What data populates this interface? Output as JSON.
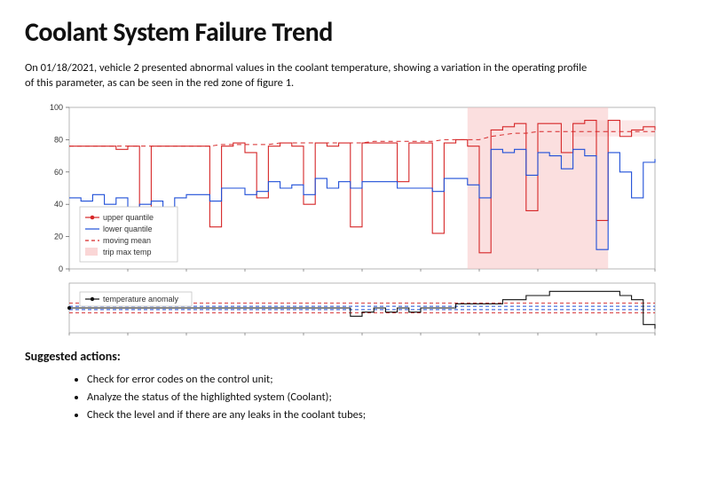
{
  "title": "Coolant System Failure Trend",
  "intro": "On 01/18/2021, vehicle 2 presented abnormal values in the coolant temperature, showing a variation in the operating profile of this parameter, as can be seen in the red zone of figure 1.",
  "suggested_heading": "Suggested actions:",
  "actions": [
    "Check for error codes on the control unit;",
    "Analyze the status of the highlighted system (Coolant);",
    "Check the level and if there are any leaks in the coolant tubes;"
  ],
  "chart_data": [
    {
      "type": "line",
      "title": "",
      "xlabel": "",
      "ylabel": "",
      "ylim": [
        0,
        100
      ],
      "yticks": [
        0,
        20,
        40,
        60,
        80,
        100
      ],
      "x": [
        0,
        2,
        4,
        6,
        8,
        10,
        12,
        14,
        16,
        18,
        20,
        22,
        24,
        26,
        28,
        30,
        32,
        34,
        36,
        38,
        40,
        42,
        44,
        46,
        48,
        50,
        52,
        54,
        56,
        58,
        60,
        62,
        64,
        66,
        68,
        70,
        72,
        74,
        76,
        78,
        80,
        82,
        84,
        86,
        88,
        90,
        92,
        94,
        96,
        98,
        100
      ],
      "series": [
        {
          "name": "upper quantile",
          "color": "#d62728",
          "style": "solid",
          "marker": "dot",
          "values": [
            76,
            76,
            76,
            76,
            74,
            76,
            34,
            76,
            76,
            76,
            76,
            76,
            26,
            76,
            78,
            72,
            44,
            76,
            78,
            76,
            40,
            78,
            76,
            78,
            26,
            78,
            78,
            78,
            54,
            78,
            78,
            22,
            78,
            80,
            76,
            10,
            86,
            88,
            90,
            36,
            90,
            90,
            72,
            90,
            92,
            30,
            92,
            82,
            86,
            88,
            86
          ]
        },
        {
          "name": "lower quantile",
          "color": "#1f4fd8",
          "style": "solid",
          "values": [
            44,
            42,
            46,
            40,
            44,
            38,
            40,
            42,
            38,
            44,
            46,
            46,
            42,
            50,
            50,
            46,
            48,
            54,
            50,
            52,
            46,
            56,
            50,
            54,
            50,
            54,
            54,
            54,
            50,
            50,
            50,
            48,
            56,
            56,
            52,
            44,
            74,
            72,
            74,
            58,
            72,
            70,
            62,
            74,
            70,
            12,
            72,
            60,
            44,
            66,
            68
          ]
        },
        {
          "name": "moving mean",
          "color": "#d62728",
          "style": "dashed",
          "values": [
            76,
            76,
            76,
            76,
            76,
            76,
            76,
            76,
            76,
            76,
            76,
            76,
            76,
            77,
            77,
            77,
            77,
            77,
            78,
            78,
            78,
            78,
            78,
            78,
            78,
            78,
            79,
            79,
            79,
            79,
            79,
            79,
            80,
            80,
            80,
            80,
            82,
            83,
            84,
            84,
            85,
            85,
            85,
            85,
            85,
            85,
            85,
            85,
            85,
            85,
            85
          ]
        }
      ],
      "highlight_zone": {
        "name": "trip max temp",
        "x_start": 68,
        "x_end": 92,
        "color": "#f8c4c4"
      },
      "legend_entries": [
        "upper quantile",
        "lower quantile",
        "moving mean",
        "trip max temp"
      ]
    },
    {
      "type": "line",
      "title": "",
      "xlabel": "",
      "ylabel": "",
      "ylim": [
        -6,
        6
      ],
      "x": [
        0,
        4,
        8,
        12,
        16,
        20,
        24,
        28,
        32,
        36,
        40,
        44,
        48,
        50,
        52,
        54,
        56,
        58,
        60,
        62,
        64,
        66,
        68,
        70,
        72,
        74,
        76,
        78,
        80,
        82,
        84,
        86,
        88,
        90,
        92,
        94,
        96,
        98,
        100
      ],
      "series": [
        {
          "name": "temperature anomaly",
          "color": "#111",
          "style": "solid",
          "marker": "dot",
          "values": [
            0,
            0,
            0,
            0,
            0,
            0,
            0,
            0,
            0,
            0,
            0,
            0,
            -2,
            -1,
            0,
            -1,
            0,
            -1,
            0,
            0,
            0,
            1,
            1,
            1,
            1,
            2,
            2,
            3,
            3,
            4,
            4,
            4,
            4,
            4,
            4,
            3,
            2,
            -4,
            -5
          ]
        }
      ],
      "reference_lines": [
        {
          "y": 1.2,
          "color": "#d62728",
          "style": "dashed"
        },
        {
          "y": 0.4,
          "color": "#1f4fd8",
          "style": "dashed"
        },
        {
          "y": -0.4,
          "color": "#1f4fd8",
          "style": "dashed"
        },
        {
          "y": -1.2,
          "color": "#d62728",
          "style": "dashed"
        }
      ],
      "legend_entries": [
        "temperature anomaly"
      ]
    }
  ],
  "colors": {
    "upper": "#d62728",
    "lower": "#1f4fd8",
    "anomaly": "#111",
    "highlight": "#f8c4c4"
  }
}
